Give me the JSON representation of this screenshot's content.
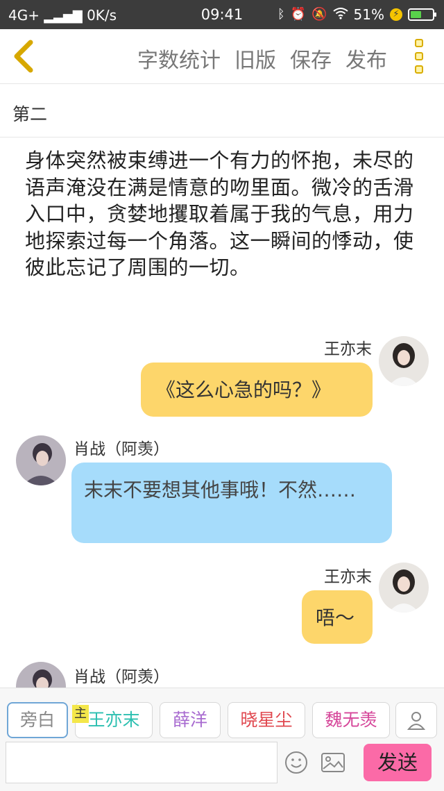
{
  "status_bar": {
    "network": "4G+",
    "speed": "0K/s",
    "time": "09:41",
    "battery": "51%",
    "battery_level": 0.51,
    "icons": [
      "signal-icon",
      "bluetooth-icon",
      "alarm-icon",
      "mute-icon",
      "wifi-icon",
      "charging-icon",
      "battery-icon"
    ]
  },
  "navbar": {
    "actions": [
      "字数统计",
      "旧版",
      "保存",
      "发布"
    ],
    "back_icon": "chevron-left-icon",
    "more_icon": "more-vertical-icon"
  },
  "chapter": {
    "title": "第二"
  },
  "narration": {
    "text": "身体突然被束缚进一个有力的怀抱，未尽的语声淹没在满是情意的吻里面。微冷的舌滑入口中，贪婪地攫取着属于我的气息，用力地探索过每一个角落。这一瞬间的悸动，使彼此忘记了周围的一切。"
  },
  "messages": [
    {
      "speaker": "王亦末",
      "text": "《这么心急的吗？》",
      "side": "right",
      "color": "#fdd66b"
    },
    {
      "speaker": "肖战（阿羡）",
      "text": "末末不要想其他事哦！不然……",
      "side": "left",
      "color": "#a6dcfb"
    },
    {
      "speaker": "王亦末",
      "text": "唔～",
      "side": "right",
      "color": "#fdd66b"
    },
    {
      "speaker": "肖战（阿羡）",
      "text": "",
      "side": "left"
    }
  ],
  "roles": [
    {
      "label": "旁白",
      "color": "#888888",
      "selected": true
    },
    {
      "label": "王亦末",
      "color": "#2bbfb0",
      "main_tag": "主"
    },
    {
      "label": "薛洋",
      "color": "#a86bd0"
    },
    {
      "label": "晓星尘",
      "color": "#e0484f"
    },
    {
      "label": "魏无羡",
      "color": "#d6479a"
    }
  ],
  "composer": {
    "input_value": "",
    "send_label": "发送",
    "emoji_icon": "smiley-icon",
    "image_icon": "image-icon",
    "add_role_icon": "person-icon"
  }
}
